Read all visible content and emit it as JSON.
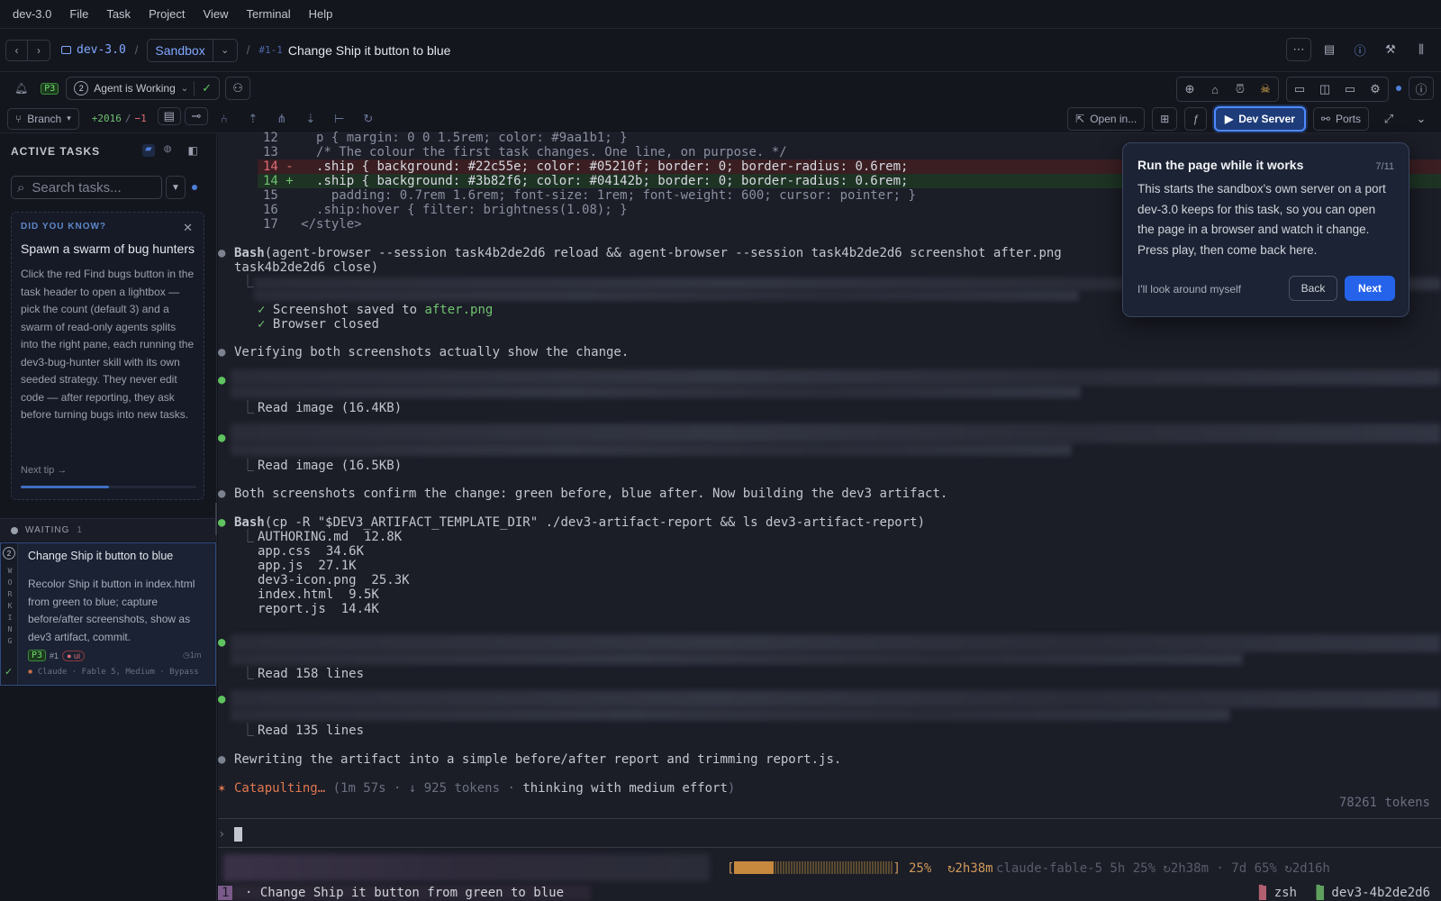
{
  "menubar": {
    "app": "dev-3.0",
    "items": [
      "File",
      "Task",
      "Project",
      "View",
      "Terminal",
      "Help"
    ]
  },
  "titlebar": {
    "project": "dev-3.0",
    "branch": "Sandbox",
    "task_id": "#1-1",
    "task_title": "Change Ship it button to blue"
  },
  "status": {
    "priority": "P3",
    "agent_count": "2",
    "agent_status": "Agent is Working"
  },
  "toolbar": {
    "branch_label": "Branch",
    "additions": "+2016",
    "deletions": "−1",
    "open_in": "Open in...",
    "dev_server": "Dev Server",
    "ports": "Ports"
  },
  "sidebar": {
    "title": "ACTIVE TASKS",
    "search_placeholder": "Search tasks...",
    "tip": {
      "kicker": "DID YOU KNOW?",
      "title": "Spawn a swarm of bug hunters",
      "body": "Click the red Find bugs button in the task header to open a lightbox — pick the count (default 3) and a swarm of read-only agents splits into the right pane, each running the dev3-bug-hunter skill with its own seeded strategy. They never edit code — after reporting, they ask before turning bugs into new tasks.",
      "next": "Next tip →",
      "progress": 0.5
    },
    "waiting": {
      "label": "WAITING",
      "count": "1"
    },
    "card": {
      "rail_number": "2",
      "rail_text": "WORKING",
      "title": "Change Ship it button to blue",
      "body": "Recolor Ship it button in index.html from green to blue; capture before/after screenshots, show as dev3 artifact, commit.",
      "priority": "P3",
      "number": "#1",
      "tag": "ui",
      "time": "1m",
      "agent": "Claude · Fable 5, Medium · Bypass"
    }
  },
  "terminal": {
    "code": [
      {
        "n": "12",
        "mark": "",
        "text": "  p { margin: 0 0 1.5rem; color: #9aa1b1; }"
      },
      {
        "n": "13",
        "mark": "",
        "text": "  /* The colour the first task changes. One line, on purpose. */"
      },
      {
        "n": "14",
        "mark": "-",
        "text": "  .ship { background: #22c55e; color: #05210f; border: 0; border-radius: 0.6rem;"
      },
      {
        "n": "14",
        "mark": "+",
        "text": "  .ship { background: #3b82f6; color: #04142b; border: 0; border-radius: 0.6rem;"
      },
      {
        "n": "15",
        "mark": "",
        "text": "    padding: 0.7rem 1.6rem; font-size: 1rem; font-weight: 600; cursor: pointer; }"
      },
      {
        "n": "16",
        "mark": "",
        "text": "  .ship:hover { filter: brightness(1.08); }"
      },
      {
        "n": "17",
        "mark": "",
        "text": "</style>"
      }
    ],
    "bash1_cmd": "Bash(agent-browser --session task4b2de2d6 reload && agent-browser --session task4b2de2d6 screenshot after.png",
    "bash1_cont": "task4b2de2d6 close)",
    "saved": "Screenshot saved to ",
    "saved_file": "after.png",
    "closed": "Browser closed",
    "verify": "Verifying both screenshots actually show the change.",
    "read1": "Read image (16.4KB)",
    "read2": "Read image (16.5KB)",
    "confirm": "Both screenshots confirm the change: green before, blue after. Now building the dev3 artifact.",
    "bash2_cmd": "Bash(cp -R \"$DEV3_ARTIFACT_TEMPLATE_DIR\" ./dev3-artifact-report && ls dev3-artifact-report)",
    "files": [
      {
        "name": "AUTHORING.md",
        "size": "12.8K"
      },
      {
        "name": "app.css",
        "size": "34.6K"
      },
      {
        "name": "app.js",
        "size": "27.1K"
      },
      {
        "name": "dev3-icon.png",
        "size": "25.3K"
      },
      {
        "name": "index.html",
        "size": "9.5K"
      },
      {
        "name": "report.js",
        "size": "14.4K"
      }
    ],
    "read3": "Read 158 lines",
    "read4": "Read 135 lines",
    "rewrite": "Rewriting the artifact into a simple before/after report and trimming report.js.",
    "spinner": "Catapulting…",
    "spinner_meta": "(1m 57s · ↓ 925 tokens · ",
    "spinner_think": "thinking with medium effort",
    "tokens": "78261 tokens",
    "usage_pct": "25%",
    "usage_fill": 0.25,
    "usage_reset": "↻2h38m",
    "usage_tail": "claude-fable-5 5h 25% ↻2h38m · 7d 65% ↻2d16h",
    "tmux_window": "1",
    "tmux_title": "· Change Ship it button from green to blue",
    "tmux_shell": "zsh",
    "tmux_session": "dev3-4b2de2d6"
  },
  "popover": {
    "title": "Run the page while it works",
    "step": "7/11",
    "body": "This starts the sandbox's own server on a port dev-3.0 keeps for this task, so you can open the page in a browser and watch it change. Press play, then come back here.",
    "skip": "I'll look around myself",
    "back": "Back",
    "next": "Next"
  },
  "colors": {
    "accent": "#2563eb",
    "add": "#6fc36f",
    "del": "#e06c75",
    "spinner": "#e0784f"
  }
}
